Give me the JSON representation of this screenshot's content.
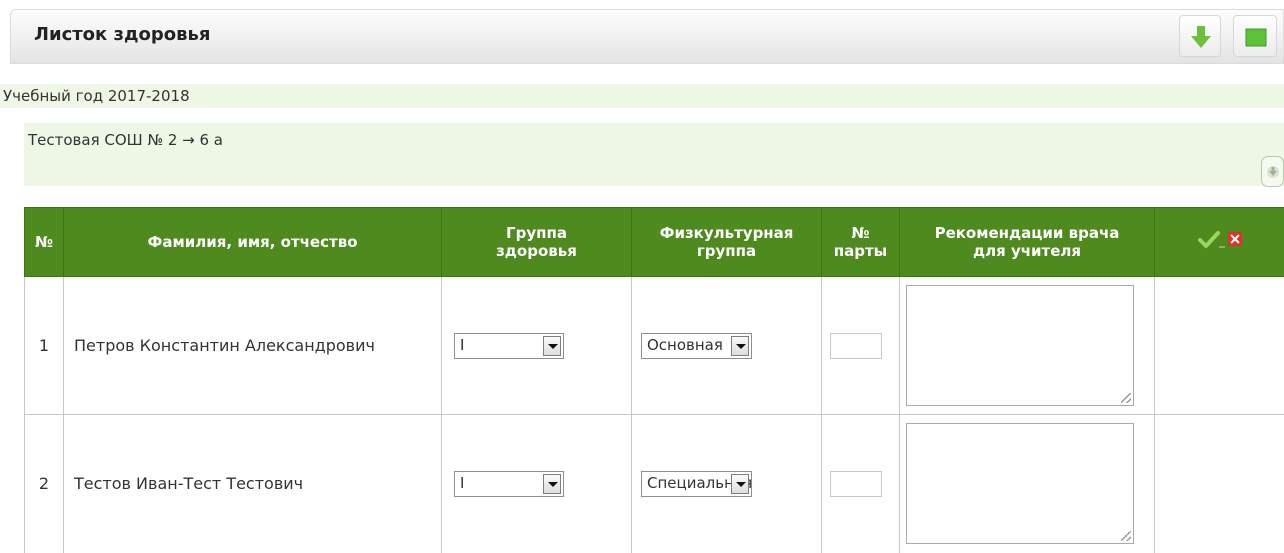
{
  "panel": {
    "title": "Листок здоровья",
    "buttons": [
      {
        "icon": "download-arrow-icon",
        "color": "#6fbf3a"
      },
      {
        "icon": "green-square-icon",
        "color": "#5cc23a"
      }
    ]
  },
  "info": {
    "year": "Учебный год 2017-2018",
    "school": "Тестовая СОШ № 2 → 6 а",
    "school_button_icon": "download-arrow-icon"
  },
  "table": {
    "columns": {
      "num": "№",
      "name": "Фамилия, имя, отчество",
      "health_group_line1": "Группа",
      "health_group_line2": "здоровья",
      "fiz_group_line1": "Физкультурная",
      "fiz_group_line2": "группа",
      "desk_line1": "№",
      "desk_line2": "парты",
      "rec_line1": "Рекомендации врача",
      "rec_line2": "для учителя",
      "actions_icons": [
        "check-icon",
        "delete-icon"
      ]
    },
    "rows": [
      {
        "num": "1",
        "name": "Петров Константин Александрович",
        "health_group": "I",
        "fiz_group": "Основная",
        "desk": "",
        "recommendation": ""
      },
      {
        "num": "2",
        "name": "Тестов Иван-Тест Тестович",
        "health_group": "I",
        "fiz_group": "Специальная",
        "desk": "",
        "recommendation": ""
      }
    ]
  },
  "colors": {
    "header_green": "#4e8a1e",
    "strip_bg": "#eef7e6",
    "check_green": "#8fd04a",
    "delete_red": "#e0322c"
  }
}
